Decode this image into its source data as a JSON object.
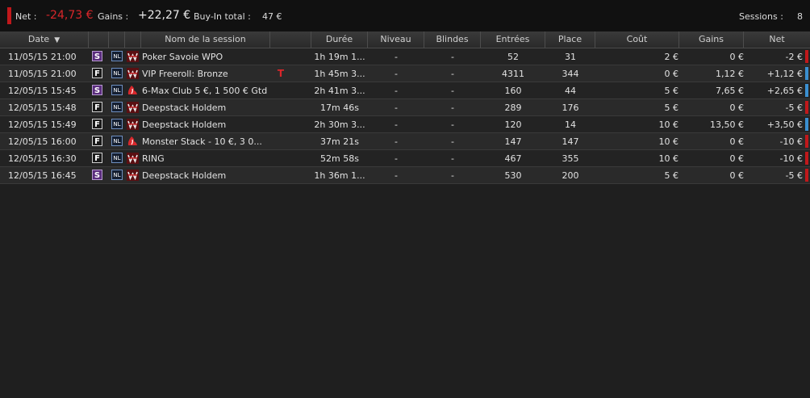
{
  "summary": {
    "net_label": "Net :",
    "net_value": "-24,73 €",
    "gains_label": "Gains :",
    "gains_value": "+22,27 €",
    "buyin_label": "Buy-In total :",
    "buyin_value": "47 €",
    "sessions_label": "Sessions :",
    "sessions_value": "8"
  },
  "columns": {
    "date": "Date",
    "name": "Nom de la session",
    "duree": "Durée",
    "niveau": "Niveau",
    "blindes": "Blindes",
    "entrees": "Entrées",
    "place": "Place",
    "cout": "Coût",
    "gains": "Gains",
    "net": "Net"
  },
  "colors": {
    "negative": "#c0181b",
    "positive": "#3a8fd0",
    "type_s": "#5b2d7e"
  },
  "rows": [
    {
      "date": "11/05/15 21:00",
      "type": "S",
      "nl": "NL",
      "room": "winamax-icon",
      "name": "Poker Savoie WPO",
      "flag": "",
      "duree": "1h 19m 1...",
      "niveau": "-",
      "blindes": "-",
      "entrees": "52",
      "place": "31",
      "cout": "2 €",
      "gains": "0 €",
      "net": "-2 €",
      "sign": "neg"
    },
    {
      "date": "11/05/15 21:00",
      "type": "F",
      "nl": "NL",
      "room": "winamax-icon",
      "name": "VIP Freeroll: Bronze",
      "flag": "T",
      "duree": "1h 45m 3...",
      "niveau": "-",
      "blindes": "-",
      "entrees": "4311",
      "place": "344",
      "cout": "0 €",
      "gains": "1,12 €",
      "net": "+1,12 €",
      "sign": "pos"
    },
    {
      "date": "12/05/15 15:45",
      "type": "S",
      "nl": "NL",
      "room": "pokerstars-icon",
      "name": "6-Max Club 5 €, 1 500 € Gtd",
      "flag": "",
      "duree": "2h 41m 3...",
      "niveau": "-",
      "blindes": "-",
      "entrees": "160",
      "place": "44",
      "cout": "5 €",
      "gains": "7,65 €",
      "net": "+2,65 €",
      "sign": "pos"
    },
    {
      "date": "12/05/15 15:48",
      "type": "F",
      "nl": "NL",
      "room": "winamax-icon",
      "name": "Deepstack Holdem",
      "flag": "",
      "duree": "17m 46s",
      "niveau": "-",
      "blindes": "-",
      "entrees": "289",
      "place": "176",
      "cout": "5 €",
      "gains": "0 €",
      "net": "-5 €",
      "sign": "neg"
    },
    {
      "date": "12/05/15 15:49",
      "type": "F",
      "nl": "NL",
      "room": "winamax-icon",
      "name": "Deepstack Holdem",
      "flag": "",
      "duree": "2h 30m 3...",
      "niveau": "-",
      "blindes": "-",
      "entrees": "120",
      "place": "14",
      "cout": "10 €",
      "gains": "13,50 €",
      "net": "+3,50 €",
      "sign": "pos"
    },
    {
      "date": "12/05/15 16:00",
      "type": "F",
      "nl": "NL",
      "room": "pokerstars-icon",
      "name": "Monster Stack - 10 €, 3 0...",
      "flag": "",
      "duree": "37m 21s",
      "niveau": "-",
      "blindes": "-",
      "entrees": "147",
      "place": "147",
      "cout": "10 €",
      "gains": "0 €",
      "net": "-10 €",
      "sign": "neg"
    },
    {
      "date": "12/05/15 16:30",
      "type": "F",
      "nl": "NL",
      "room": "winamax-icon",
      "name": "RING",
      "flag": "",
      "duree": "52m 58s",
      "niveau": "-",
      "blindes": "-",
      "entrees": "467",
      "place": "355",
      "cout": "10 €",
      "gains": "0 €",
      "net": "-10 €",
      "sign": "neg"
    },
    {
      "date": "12/05/15 16:45",
      "type": "S",
      "nl": "NL",
      "room": "winamax-icon",
      "name": "Deepstack Holdem",
      "flag": "",
      "duree": "1h 36m 1...",
      "niveau": "-",
      "blindes": "-",
      "entrees": "530",
      "place": "200",
      "cout": "5 €",
      "gains": "0 €",
      "net": "-5 €",
      "sign": "neg"
    }
  ]
}
